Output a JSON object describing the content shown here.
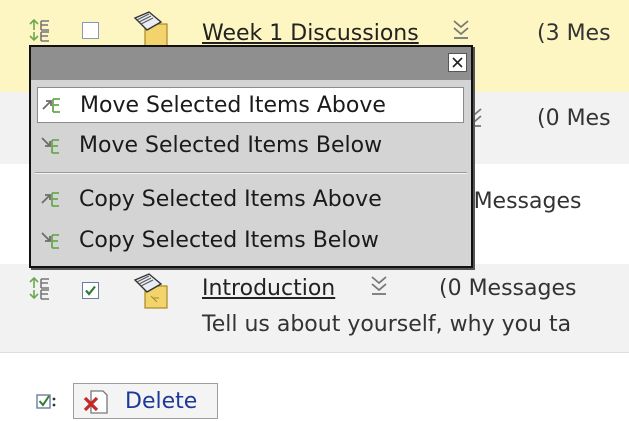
{
  "topics": [
    {
      "title": "Week 1 Discussions",
      "count": "(3 Mes",
      "checked": false
    },
    {
      "count": "(0 Mes"
    },
    {
      "count": ") Messages"
    },
    {
      "title": "Introduction",
      "count": "(0 Messages",
      "description": "Tell us about yourself, why you ta",
      "checked": true
    }
  ],
  "reorder_menu": {
    "items": [
      {
        "label": "Move Selected Items Above",
        "icon": "move-above-icon",
        "active": true
      },
      {
        "label": "Move Selected Items Below",
        "icon": "move-below-icon",
        "active": false
      },
      {
        "label": "Copy Selected Items Above",
        "icon": "copy-above-icon",
        "active": false
      },
      {
        "label": "Copy Selected Items Below",
        "icon": "copy-below-icon",
        "active": false
      }
    ],
    "close_icon": "close-icon"
  },
  "footer": {
    "select_icon": "select-all-checkbox-icon",
    "delete_label": "Delete",
    "delete_icon": "delete-x-icon"
  },
  "colors": {
    "highlight_row": "#fdf6c3",
    "alt_row": "#f2f2f2",
    "link_blue": "#1d3a9a",
    "check_green": "#2e7d32"
  }
}
